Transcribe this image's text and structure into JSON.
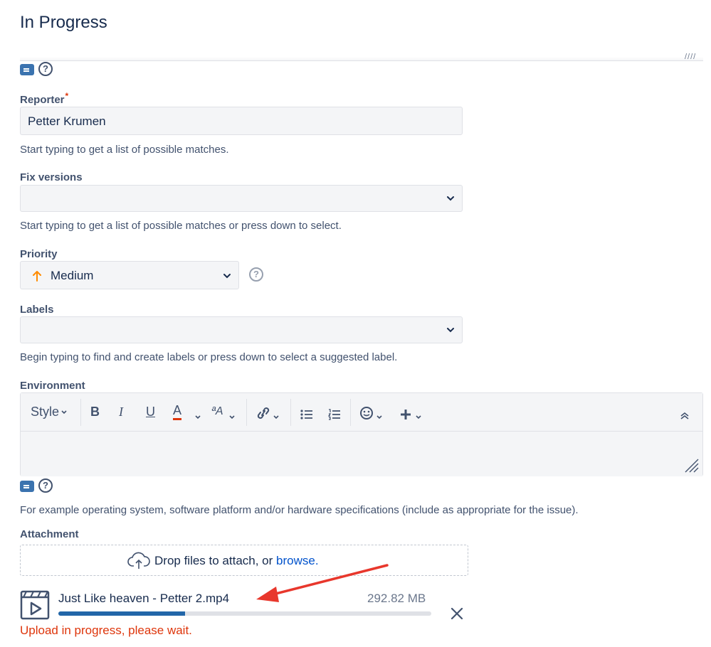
{
  "header": {
    "title": "In Progress"
  },
  "top_edge": {
    "resize_glyph": "////"
  },
  "reporter": {
    "label": "Reporter",
    "required_marker": "*",
    "value": "Petter Krumen",
    "hint": "Start typing to get a list of possible matches."
  },
  "fix_versions": {
    "label": "Fix versions",
    "value": "",
    "hint": "Start typing to get a list of possible matches or press down to select."
  },
  "priority": {
    "label": "Priority",
    "value": "Medium",
    "icon": "arrow-up-icon",
    "icon_color": "#ff8b00"
  },
  "labels": {
    "label": "Labels",
    "value": "",
    "hint": "Begin typing to find and create labels or press down to select a suggested label."
  },
  "environment": {
    "label": "Environment",
    "toolbar": {
      "style_label": "Style",
      "bold": "B",
      "italic": "I",
      "underline": "U",
      "text_color": "A",
      "text_size": "ªA"
    },
    "hint": "For example operating system, software platform and/or hardware specifications (include as appropriate for the issue)."
  },
  "attachment": {
    "label": "Attachment",
    "drop_text": "Drop files to attach, or ",
    "browse_link": "browse.",
    "file": {
      "name": "Just Like heaven - Petter 2.mp4",
      "size": "292.82 MB",
      "progress": 0.34
    },
    "upload_message": "Upload in progress, please wait."
  },
  "colors": {
    "heading": "#172b4d",
    "label": "#42526e",
    "error": "#de350b",
    "link": "#0052cc",
    "progress": "#2266a8",
    "annotation_arrow": "#e8372c"
  }
}
